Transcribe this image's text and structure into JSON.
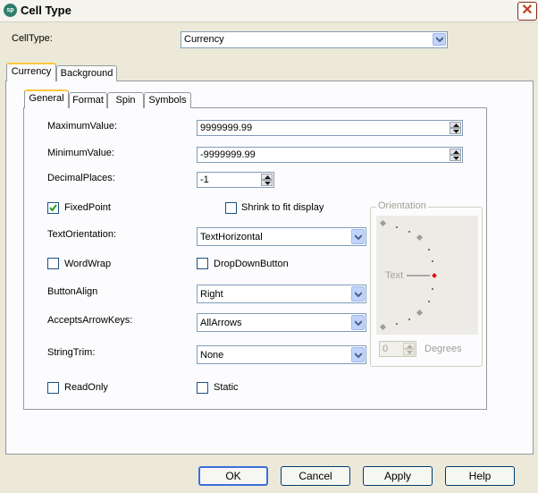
{
  "window": {
    "title": "Cell Type",
    "app_icon": "sp"
  },
  "celltype": {
    "label": "CellType:",
    "value": "Currency"
  },
  "outer_tabs": [
    {
      "label": "Currency"
    },
    {
      "label": "Background"
    }
  ],
  "inner_tabs": [
    {
      "label": "General"
    },
    {
      "label": "Format"
    },
    {
      "label": "Spin"
    },
    {
      "label": "Symbols"
    }
  ],
  "general": {
    "maximum": {
      "label": "MaximumValue:",
      "value": "9999999.99"
    },
    "minimum": {
      "label": "MinimumValue:",
      "value": "-9999999.99"
    },
    "decimal": {
      "label": "DecimalPlaces:",
      "value": "-1"
    },
    "fixedpoint": {
      "label": "FixedPoint",
      "checked": true
    },
    "shrink": {
      "label": "Shrink to fit display",
      "checked": false
    },
    "text_orientation": {
      "label": "TextOrientation:",
      "value": "TextHorizontal"
    },
    "wordwrap": {
      "label": "WordWrap",
      "checked": false
    },
    "dropdown": {
      "label": "DropDownButton",
      "checked": false
    },
    "button_align": {
      "label": "ButtonAlign",
      "value": "Right"
    },
    "accepts_arrow": {
      "label": "AcceptsArrowKeys:",
      "value": "AllArrows"
    },
    "string_trim": {
      "label": "StringTrim:",
      "value": "None"
    },
    "readonly": {
      "label": "ReadOnly",
      "checked": false
    },
    "static": {
      "label": "Static",
      "checked": false
    }
  },
  "orientation": {
    "title": "Orientation",
    "preview_text": "Text",
    "degrees_value": "0",
    "degrees_label": "Degrees"
  },
  "buttons": {
    "ok": "OK",
    "cancel": "Cancel",
    "apply": "Apply",
    "help": "Help"
  },
  "colors": {
    "accent": "#ffc83c",
    "dial_marker": "#e00000",
    "dial_dot": "#a09d92"
  }
}
